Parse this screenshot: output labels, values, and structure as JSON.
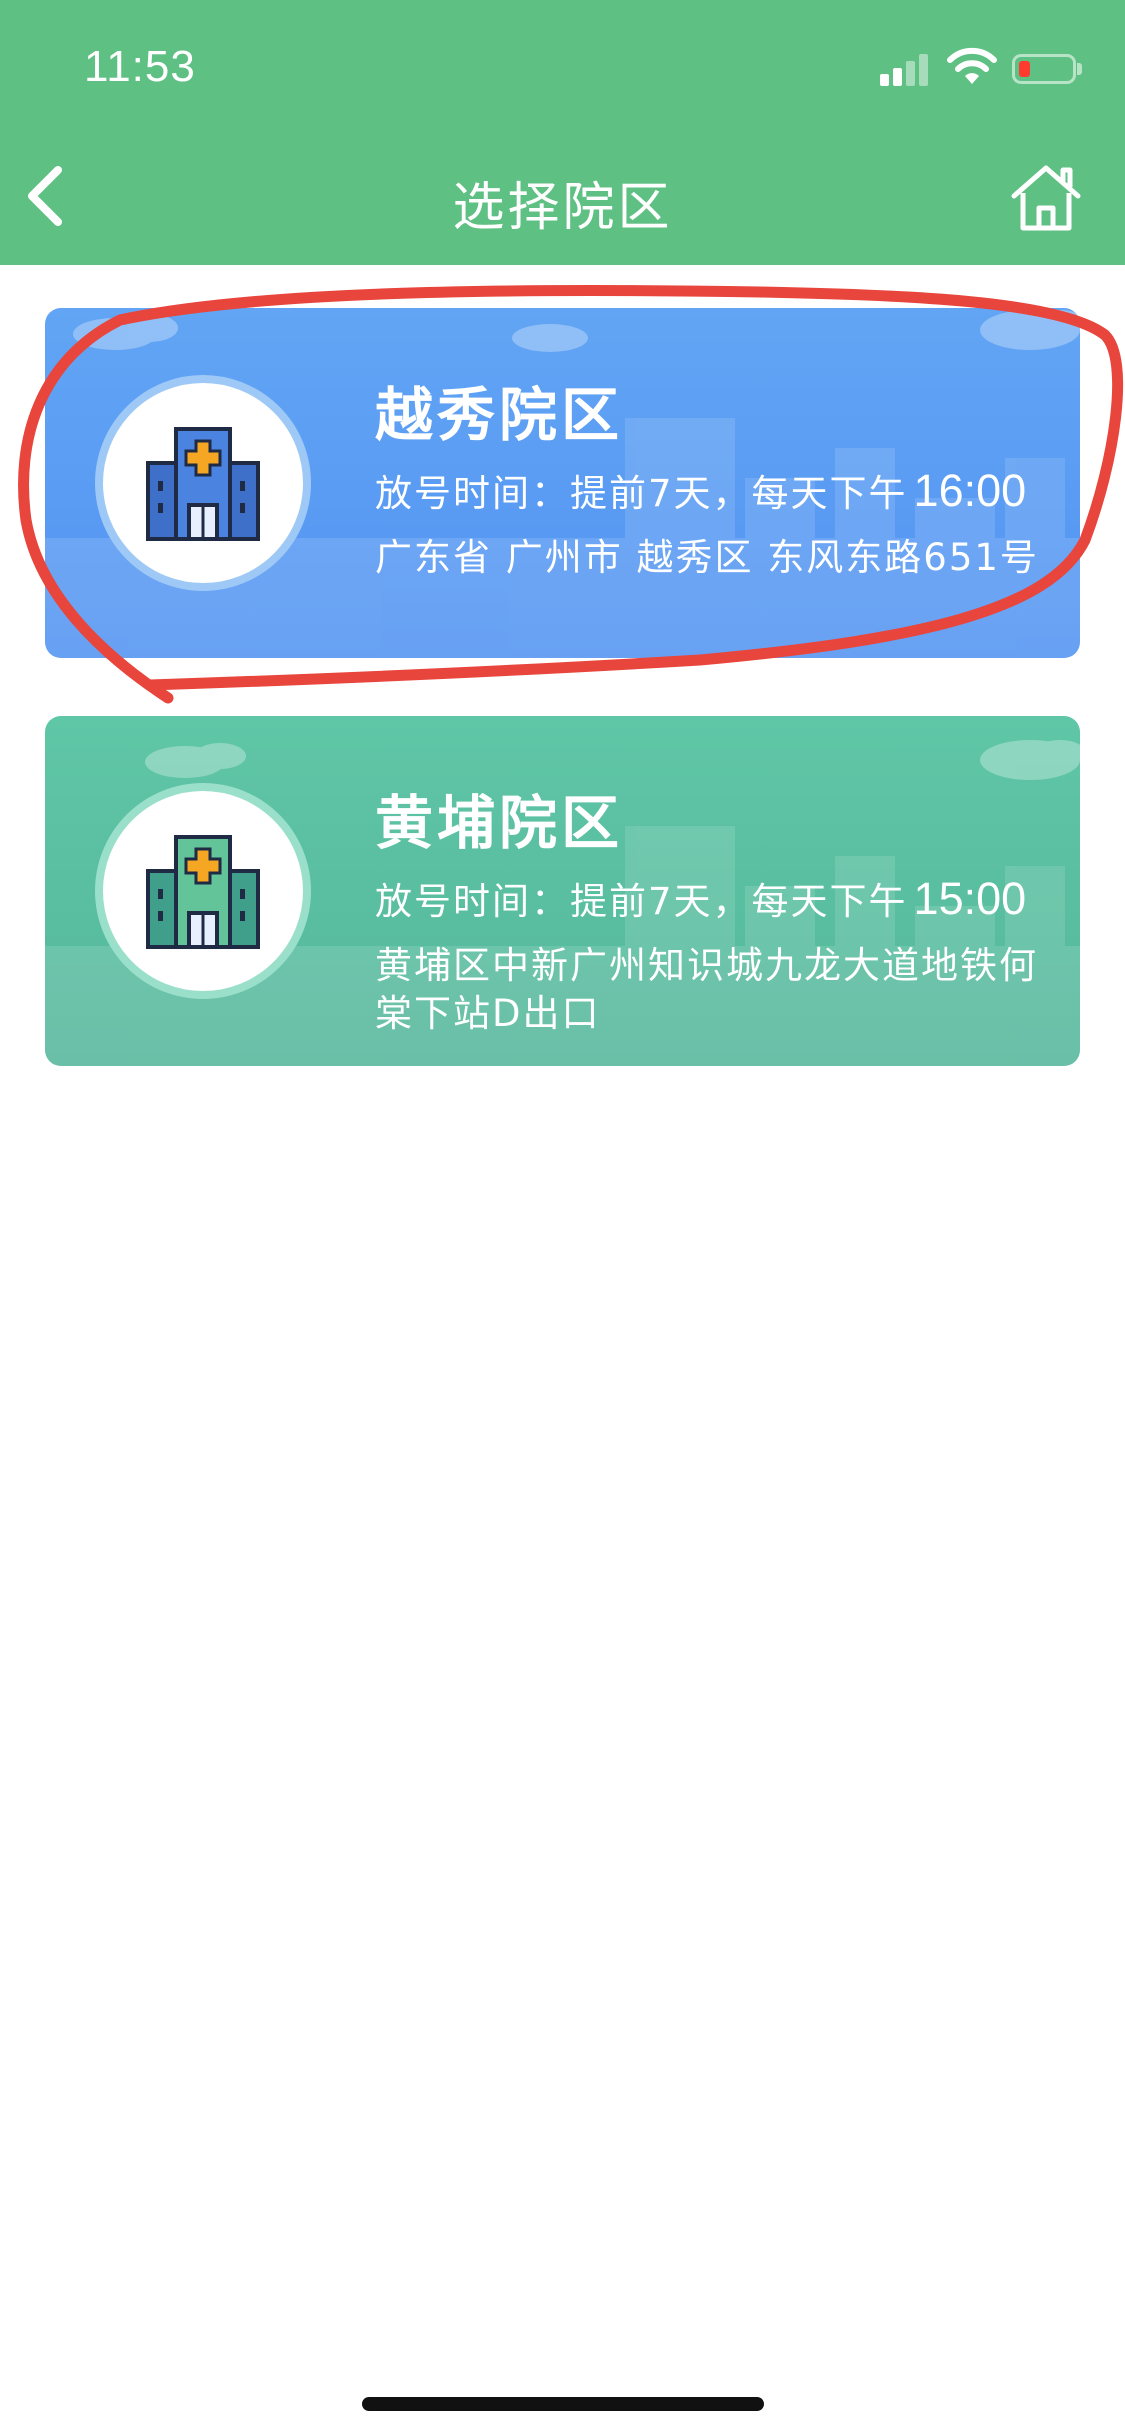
{
  "status_bar": {
    "time": "11:53"
  },
  "header": {
    "title": "选择院区",
    "back_icon": "chevron-left-icon",
    "home_icon": "home-icon"
  },
  "campuses": [
    {
      "name": "越秀院区",
      "release_label": "放号时间：提前7天，每天下午",
      "release_time": "16:00",
      "address": "广东省 广州市 越秀区 东风东路651号",
      "color": "#5a9df3"
    },
    {
      "name": "黄埔院区",
      "release_label": "放号时间：提前7天，每天下午",
      "release_time": "15:00",
      "address": "黄埔区中新广州知识城九龙大道地铁何棠下站D出口",
      "color": "#5abf9f"
    }
  ],
  "colors": {
    "header_bg": "#5fc083",
    "annotation": "#e8453c"
  }
}
